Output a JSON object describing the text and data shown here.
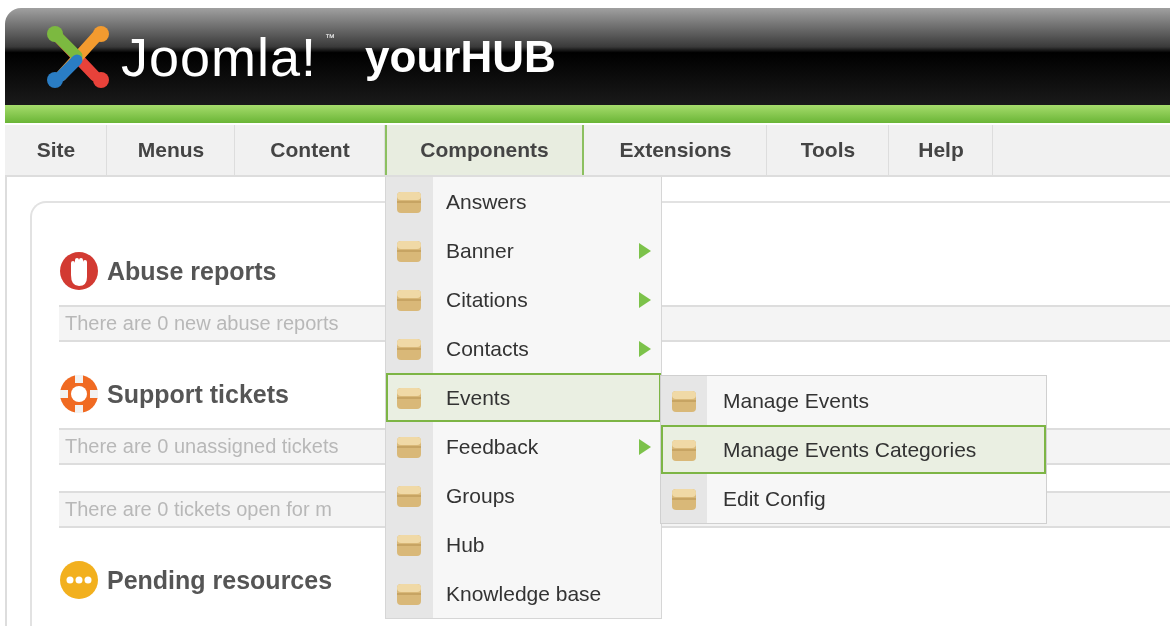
{
  "header": {
    "logo_text": "Joomla!",
    "trademark": "™",
    "site_name": "yourHUB"
  },
  "menu_bar": [
    {
      "label": "Site",
      "selected": false
    },
    {
      "label": "Menus",
      "selected": false
    },
    {
      "label": "Content",
      "selected": false
    },
    {
      "label": "Components",
      "selected": true
    },
    {
      "label": "Extensions",
      "selected": false
    },
    {
      "label": "Tools",
      "selected": false
    },
    {
      "label": "Help",
      "selected": false
    }
  ],
  "sections": [
    {
      "title": "Abuse reports",
      "messages": [
        "There are 0 new abuse reports"
      ]
    },
    {
      "title": "Support tickets",
      "messages": [
        "There are 0 unassigned tickets",
        "There are 0 tickets open for m"
      ]
    },
    {
      "title": "Pending resources"
    }
  ],
  "dropdown": {
    "items": [
      {
        "label": "Answers",
        "has_submenu": false,
        "selected": false
      },
      {
        "label": "Banner",
        "has_submenu": true,
        "selected": false
      },
      {
        "label": "Citations",
        "has_submenu": true,
        "selected": false
      },
      {
        "label": "Contacts",
        "has_submenu": true,
        "selected": false
      },
      {
        "label": "Events",
        "has_submenu": false,
        "selected": true
      },
      {
        "label": "Feedback",
        "has_submenu": true,
        "selected": false
      },
      {
        "label": "Groups",
        "has_submenu": false,
        "selected": false
      },
      {
        "label": "Hub",
        "has_submenu": false,
        "selected": false
      },
      {
        "label": "Knowledge base",
        "has_submenu": false,
        "selected": false
      }
    ]
  },
  "submenu": {
    "items": [
      {
        "label": "Manage Events",
        "selected": false
      },
      {
        "label": "Manage Events Categories",
        "selected": true
      },
      {
        "label": "Edit Config",
        "selected": false
      }
    ]
  }
}
